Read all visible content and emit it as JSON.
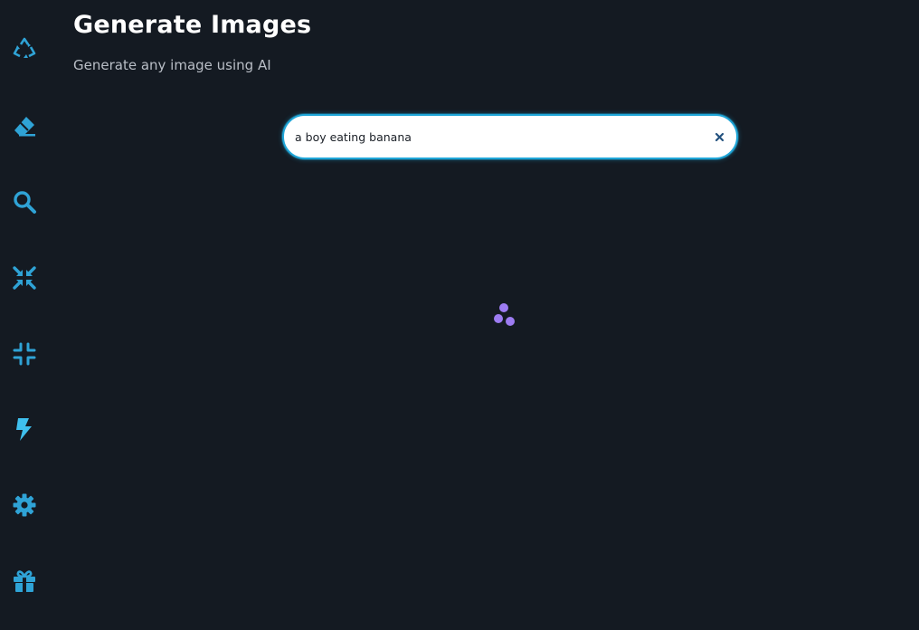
{
  "header": {
    "title": "Generate Images",
    "subtitle": "Generate any image using AI"
  },
  "sidebar": {
    "items": [
      {
        "icon": "recycle-icon",
        "active": false
      },
      {
        "icon": "eraser-icon",
        "active": false
      },
      {
        "icon": "search-icon",
        "active": false
      },
      {
        "icon": "compress-arrows-icon",
        "active": false
      },
      {
        "icon": "compress-icon",
        "active": false
      },
      {
        "icon": "bolt-icon",
        "active": true
      },
      {
        "icon": "gear-icon",
        "active": false
      },
      {
        "icon": "gift-icon",
        "active": false
      }
    ]
  },
  "search": {
    "value": "a boy eating banana",
    "clear_icon": "close-icon"
  },
  "loader": {
    "icon": "loading-dots-icon"
  },
  "colors": {
    "background": "#141a22",
    "icon": "#2fa3d6",
    "active_icon": "#3fc0ee",
    "accent_border": "#1fa6d8",
    "loader": "#9d7cf2"
  }
}
